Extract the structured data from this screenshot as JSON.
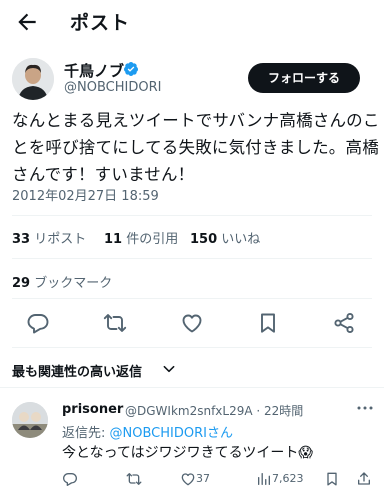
{
  "header": {
    "title": "ポスト",
    "back_icon": "arrow-left-icon"
  },
  "author": {
    "name": "千鳥ノブ",
    "handle": "@NOBCHIDORI",
    "verified_icon": "verified-badge-icon",
    "follow_label": "フォローする"
  },
  "tweet": {
    "text": "なんとまる見えツイートでサバンナ高橋さんのことを呼び捨てにしてる失敗に気付きました。高橋さんです！すいません！",
    "timestamp": "2012年02月27日 18:59"
  },
  "stats": {
    "reposts_count": "33",
    "reposts_label": "リポスト",
    "quotes_count": "11",
    "quotes_label": "件の引用",
    "likes_count": "150",
    "likes_label": "いいね",
    "bookmarks_count": "29",
    "bookmarks_label": "ブックマーク"
  },
  "actions": [
    "reply-icon",
    "repost-icon",
    "like-icon",
    "bookmark-icon",
    "share-icon"
  ],
  "replies_section": {
    "label": "最も関連性の高い返信"
  },
  "reply": {
    "name": "prisoner",
    "handle_time": "@DGWIkm2snfxL29A · 22時間",
    "reply_to_label": "返信先: ",
    "reply_to_handle": "@NOBCHIDORIさん",
    "text": "今となってはジワジワきてるツイート😱",
    "replies_count": "",
    "reposts_count": "",
    "likes_count": "37",
    "views_count": "7,623"
  },
  "colors": {
    "accent": "#1d9bf0",
    "text": "#0f1419",
    "muted": "#536471",
    "button": "#0f1419"
  }
}
